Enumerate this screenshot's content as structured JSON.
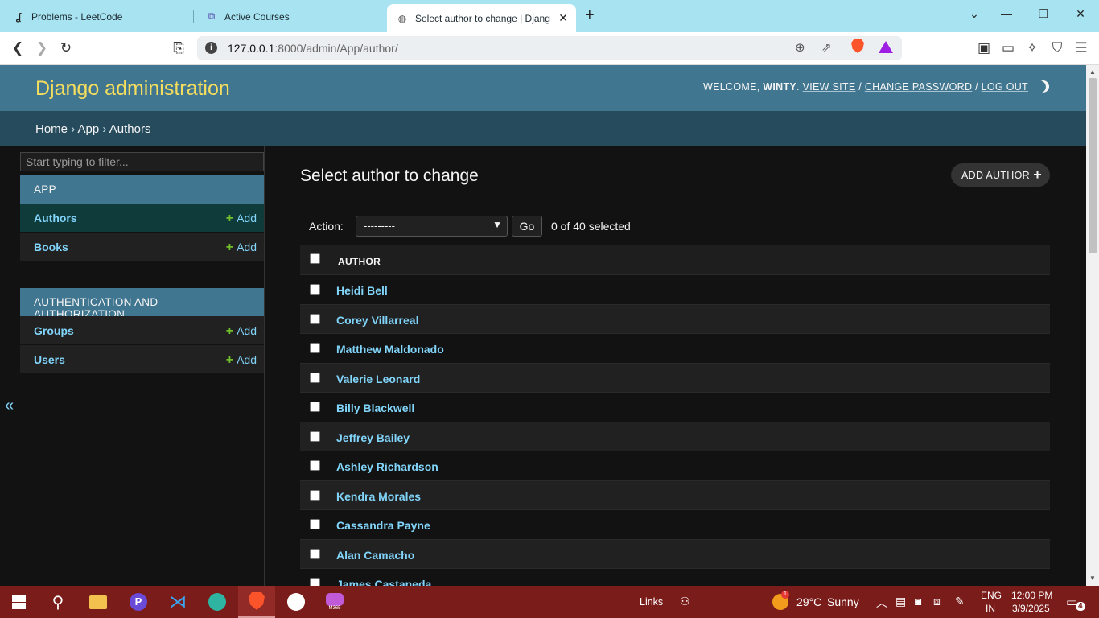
{
  "browser": {
    "tabs": [
      {
        "title": "Problems - LeetCode",
        "icon": "leetcode-icon",
        "active": false
      },
      {
        "title": "Active Courses",
        "icon": "course-icon",
        "active": false
      },
      {
        "title": "Select author to change | Djang",
        "icon": "globe-icon",
        "active": true
      }
    ],
    "url_host": "127.0.0.1",
    "url_rest": ":8000/admin/App/author/"
  },
  "header": {
    "branding": "Django administration",
    "welcome_prefix": "WELCOME, ",
    "username": "WINTY",
    "welcome_suffix": ".",
    "view_site": "VIEW SITE",
    "change_password": "CHANGE PASSWORD",
    "log_out": "LOG OUT",
    "sep": "/"
  },
  "breadcrumbs": {
    "home": "Home",
    "app": "App",
    "current": "Authors",
    "sep": "›"
  },
  "sidebar": {
    "filter_placeholder": "Start typing to filter...",
    "modules": [
      {
        "caption": "APP",
        "models": [
          {
            "name": "Authors",
            "add": "Add",
            "current": true
          },
          {
            "name": "Books",
            "add": "Add",
            "current": false
          }
        ]
      },
      {
        "caption": "AUTHENTICATION AND AUTHORIZATION",
        "models": [
          {
            "name": "Groups",
            "add": "Add",
            "current": false
          },
          {
            "name": "Users",
            "add": "Add",
            "current": false
          }
        ]
      }
    ],
    "collapse_glyph": "«"
  },
  "content": {
    "title": "Select author to change",
    "add_button": "ADD AUTHOR",
    "action_label": "Action:",
    "action_selected": "---------",
    "go_button": "Go",
    "selection_count": "0 of 40 selected",
    "column_header": "AUTHOR",
    "authors": [
      "Heidi Bell",
      "Corey Villarreal",
      "Matthew Maldonado",
      "Valerie Leonard",
      "Billy Blackwell",
      "Jeffrey Bailey",
      "Ashley Richardson",
      "Kendra Morales",
      "Cassandra Payne",
      "Alan Camacho",
      "James Castaneda"
    ]
  },
  "taskbar": {
    "links_label": "Links",
    "weather_temp": "29°C",
    "weather_desc": "Sunny",
    "weather_badge": "1",
    "lang_top": "ENG",
    "lang_bottom": "IN",
    "time": "12:00 PM",
    "date": "3/9/2025",
    "notification_count": "4",
    "m365_label": "M365"
  },
  "colors": {
    "header_bg": "#417690",
    "breadcrumb_bg": "#264b5d",
    "branding": "#f5dd5d",
    "link": "#81d4fa",
    "add_plus": "#70bf2b",
    "taskbar_bg": "#7a1c1a"
  }
}
